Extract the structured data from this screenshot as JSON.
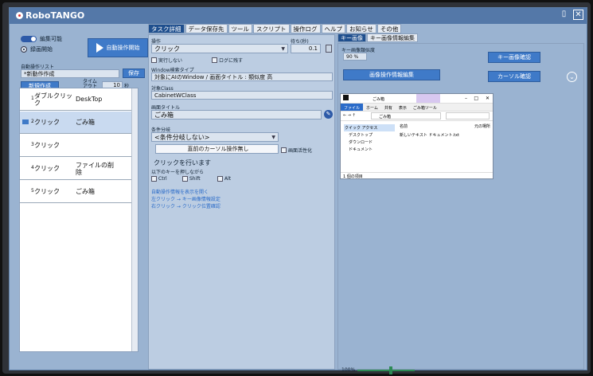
{
  "app": {
    "title": "RoboTANGO"
  },
  "left": {
    "toggle_label": "編集可能",
    "radio_label": "録画開始",
    "play_label": "自動操作開始",
    "section_label": "自動操作リスト",
    "list_name": "*新動作作成",
    "save_label": "保存",
    "new_label": "新規作成",
    "wait_label": "タイム\nアウト",
    "wait_value": "10",
    "wait_unit": "秒",
    "items": [
      {
        "num": "1",
        "action": "ダブルクリック",
        "target": "DeskTop",
        "selected": false
      },
      {
        "num": "2",
        "action": "クリック",
        "target": "ごみ箱",
        "selected": true
      },
      {
        "num": "3",
        "action": "クリック",
        "target": "",
        "selected": false
      },
      {
        "num": "4",
        "action": "クリック",
        "target": "ファイルの削除",
        "selected": false
      },
      {
        "num": "5",
        "action": "クリック",
        "target": "ごみ箱",
        "selected": false
      }
    ]
  },
  "mid": {
    "tabs": [
      "タスク詳細",
      "データ保存先",
      "ツール",
      "スクリプト",
      "操作ログ",
      "ヘルプ",
      "お知らせ",
      "その他"
    ],
    "op_label": "操作",
    "op_value": "クリック",
    "wait_label": "待ち(秒)",
    "wait_value": "0.1",
    "chk_noexec": "実行しない",
    "chk_log": "ログに残す",
    "window_type_label": "Window検索タイプ",
    "window_type_value": "対象にAIのWindow / 画面タイトル : 類似度 高",
    "target_class_label": "対象Class",
    "target_class_value": "CabinetWClass",
    "screen_title_label": "画面タイトル",
    "screen_title_value": "ごみ箱",
    "cond_label": "条件分岐",
    "cond_value": "<条件分岐しない>",
    "mouse_label": "直前のカーソル操作無し",
    "direct_exec_label": "画面活性化",
    "click_heading": "クリックを行います",
    "modkeys_label": "以下のキーを押しながら",
    "ctrl_label": "Ctrl",
    "shift_label": "Shift",
    "alt_label": "Alt",
    "link1": "自動操作情報を表示を開く",
    "link2": "左クリック → キー画像情報設定",
    "link3": "右クリック → クリック位置確認"
  },
  "right": {
    "tabs": [
      "キー画像",
      "キー画像情報編集"
    ],
    "ratio_label": "キー画像類似度",
    "ratio_value": "90 %",
    "confirm_button": "キー画像確認",
    "edit_button": "画像操作情報編集",
    "cursor_button": "カーソル確認",
    "zoom_label": "100%",
    "zoom_fraction": 0.55,
    "preview": {
      "title": "ごみ箱",
      "ribbon": [
        "ファイル",
        "ホーム",
        "共有",
        "表示",
        "ごみ箱ツール"
      ],
      "address": "ごみ箱",
      "nav": [
        "クイック アクセス",
        "デスクトップ",
        "ダウンロード",
        "ドキュメント"
      ],
      "content_header": "名前",
      "content_item": "新しいテキスト ドキュメント.txt",
      "content_col": "元の場所",
      "footer": "1 個の項目"
    }
  }
}
